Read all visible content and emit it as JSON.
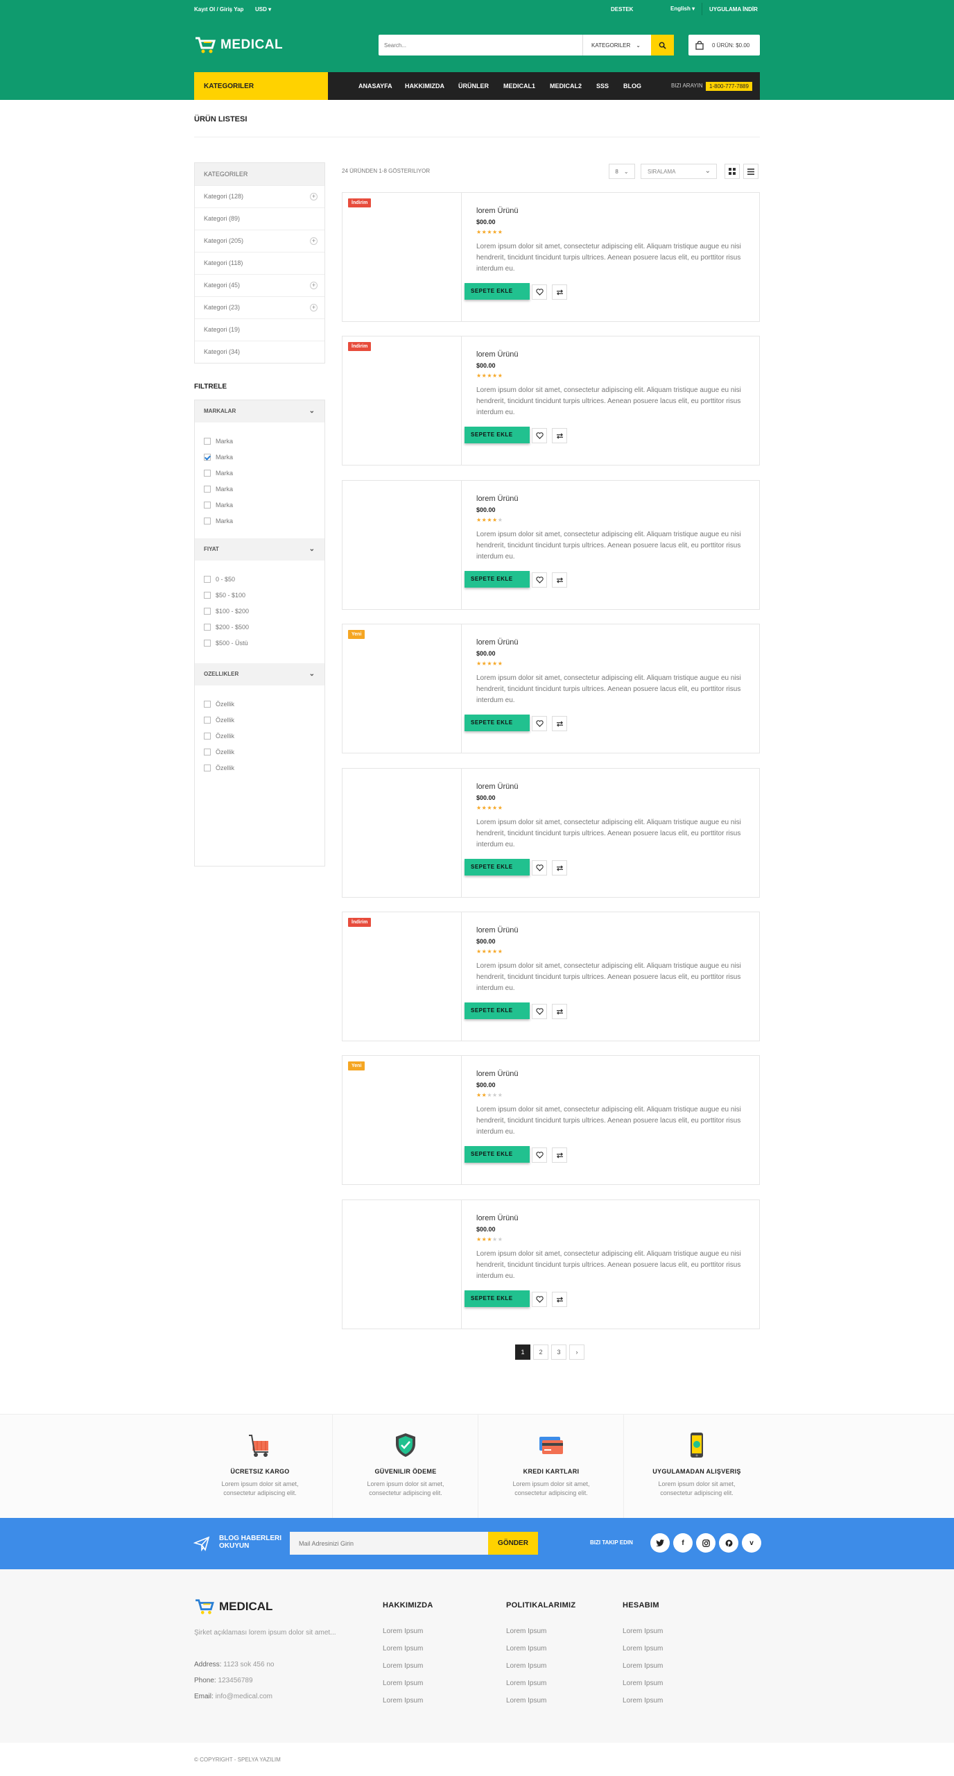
{
  "topbar": {
    "login": "Kayıt Ol / Giriş Yap",
    "currency": "USD",
    "support": "DESTEK",
    "language": "English",
    "app_download": "UYGULAMA İNDİR"
  },
  "brand": {
    "name": "MEDICAL"
  },
  "search": {
    "placeholder": "Search...",
    "category": "KATEGORILER"
  },
  "cart": {
    "label": "0 ÜRÜN: $0.00"
  },
  "nav": {
    "categories": "KATEGORILER",
    "items": [
      "ANASAYFA",
      "HAKKIMIZDA",
      "ÜRÜNLER",
      "MEDICAL1",
      "MEDICAL2",
      "SSS",
      "BLOG"
    ],
    "call_label": "BIZI ARAYIN",
    "call_number": "1-800-777-7889"
  },
  "page": {
    "title": "ÜRÜN LISTESI"
  },
  "sidebar": {
    "categories_title": "KATEGORILER",
    "categories": [
      {
        "label": "Kategori",
        "count": "(128)",
        "expandable": true
      },
      {
        "label": "Kategori",
        "count": "(89)",
        "expandable": false
      },
      {
        "label": "Kategori",
        "count": "(205)",
        "expandable": true
      },
      {
        "label": "Kategori",
        "count": "(118)",
        "expandable": false
      },
      {
        "label": "Kategori",
        "count": "(45)",
        "expandable": true
      },
      {
        "label": "Kategori",
        "count": "(23)",
        "expandable": true
      },
      {
        "label": "Kategori",
        "count": "(19)",
        "expandable": false
      },
      {
        "label": "Kategori",
        "count": "(34)",
        "expandable": false
      }
    ],
    "filter_title": "FILTRELE",
    "brands_title": "MARKALAR",
    "brands": [
      {
        "label": "Marka",
        "checked": false
      },
      {
        "label": "Marka",
        "checked": true
      },
      {
        "label": "Marka",
        "checked": false
      },
      {
        "label": "Marka",
        "checked": false
      },
      {
        "label": "Marka",
        "checked": false
      },
      {
        "label": "Marka",
        "checked": false
      }
    ],
    "price_title": "FIYAT",
    "prices": [
      "0 - $50",
      "$50 - $100",
      "$100 - $200",
      "$200 - $500",
      "$500 - Üstü"
    ],
    "features_title": "OZELLIKLER",
    "features": [
      "Özellik",
      "Özellik",
      "Özellik",
      "Özellik",
      "Özellik"
    ]
  },
  "listing": {
    "showing": "24 ÜRÜNDEN 1-8 GÖSTERILIYOR",
    "per_page": "8",
    "sort": "SIRALAMA"
  },
  "products": [
    {
      "name": "lorem Ürünü",
      "price": "$00.00",
      "rating": 5,
      "badge": "İndirim",
      "badge_color": "#e74c3c",
      "desc": "Lorem ipsum dolor sit amet, consectetur adipiscing elit. Aliquam tristique augue eu nisi hendrerit, tincidunt tincidunt turpis ultrices. Aenean posuere lacus elit, eu porttitor risus interdum eu.",
      "add_label": "SEPETE EKLE"
    },
    {
      "name": "lorem Ürünü",
      "price": "$00.00",
      "rating": 5,
      "badge": "İndirim",
      "badge_color": "#e74c3c",
      "desc": "Lorem ipsum dolor sit amet, consectetur adipiscing elit. Aliquam tristique augue eu nisi hendrerit, tincidunt tincidunt turpis ultrices. Aenean posuere lacus elit, eu porttitor risus interdum eu.",
      "add_label": "SEPETE EKLE"
    },
    {
      "name": "lorem Ürünü",
      "price": "$00.00",
      "rating": 4,
      "badge": "",
      "badge_color": "",
      "desc": "Lorem ipsum dolor sit amet, consectetur adipiscing elit. Aliquam tristique augue eu nisi hendrerit, tincidunt tincidunt turpis ultrices. Aenean posuere lacus elit, eu porttitor risus interdum eu.",
      "add_label": "SEPETE EKLE"
    },
    {
      "name": "lorem Ürünü",
      "price": "$00.00",
      "rating": 5,
      "badge": "Yeni",
      "badge_color": "#f5a623",
      "desc": "Lorem ipsum dolor sit amet, consectetur adipiscing elit. Aliquam tristique augue eu nisi hendrerit, tincidunt tincidunt turpis ultrices. Aenean posuere lacus elit, eu porttitor risus interdum eu.",
      "add_label": "SEPETE EKLE"
    },
    {
      "name": "lorem Ürünü",
      "price": "$00.00",
      "rating": 5,
      "badge": "",
      "badge_color": "",
      "desc": "Lorem ipsum dolor sit amet, consectetur adipiscing elit. Aliquam tristique augue eu nisi hendrerit, tincidunt tincidunt turpis ultrices. Aenean posuere lacus elit, eu porttitor risus interdum eu.",
      "add_label": "SEPETE EKLE"
    },
    {
      "name": "lorem Ürünü",
      "price": "$00.00",
      "rating": 5,
      "badge": "İndirim",
      "badge_color": "#e74c3c",
      "desc": "Lorem ipsum dolor sit amet, consectetur adipiscing elit. Aliquam tristique augue eu nisi hendrerit, tincidunt tincidunt turpis ultrices. Aenean posuere lacus elit, eu porttitor risus interdum eu.",
      "add_label": "SEPETE EKLE"
    },
    {
      "name": "lorem Ürünü",
      "price": "$00.00",
      "rating": 2,
      "badge": "Yeni",
      "badge_color": "#f5a623",
      "desc": "Lorem ipsum dolor sit amet, consectetur adipiscing elit. Aliquam tristique augue eu nisi hendrerit, tincidunt tincidunt turpis ultrices. Aenean posuere lacus elit, eu porttitor risus interdum eu.",
      "add_label": "SEPETE EKLE"
    },
    {
      "name": "lorem Ürünü",
      "price": "$00.00",
      "rating": 3,
      "badge": "",
      "badge_color": "",
      "desc": "Lorem ipsum dolor sit amet, consectetur adipiscing elit. Aliquam tristique augue eu nisi hendrerit, tincidunt tincidunt turpis ultrices. Aenean posuere lacus elit, eu porttitor risus interdum eu.",
      "add_label": "SEPETE EKLE"
    }
  ],
  "pagination": [
    "1",
    "2",
    "3",
    "›"
  ],
  "features": [
    {
      "title": "ÜCRETSIZ KARGO",
      "desc": "Lorem ipsum dolor sit amet, consectetur adipiscing elit.",
      "icon": "truck-icon"
    },
    {
      "title": "GÜVENILIR ÖDEME",
      "desc": "Lorem ipsum dolor sit amet, consectetur adipiscing elit.",
      "icon": "shield-icon"
    },
    {
      "title": "KREDI KARTLARI",
      "desc": "Lorem ipsum dolor sit amet, consectetur adipiscing elit.",
      "icon": "credit-card-icon"
    },
    {
      "title": "UYGULAMADAN ALIŞVERIŞ",
      "desc": "Lorem ipsum dolor sit amet, consectetur adipiscing elit.",
      "icon": "phone-icon"
    }
  ],
  "newsletter": {
    "label": "BLOG HABERLERI OKUYUN",
    "placeholder": "Mail Adresinizi Girin",
    "button": "GÖNDER",
    "follow": "BIZI TAKIP EDIN",
    "social": [
      "twitter",
      "facebook",
      "instagram",
      "pinterest",
      "vimeo"
    ]
  },
  "footer": {
    "brand": "MEDICAL",
    "desc": "Şirket açıklaması lorem ipsum dolor sit amet...",
    "address_label": "Address:",
    "address": "1123 sok 456 no",
    "phone_label": "Phone:",
    "phone": "123456789",
    "email_label": "Email:",
    "email": "info@medical.com",
    "columns": [
      {
        "title": "HAKKIMIZDA",
        "links": [
          "Lorem Ipsum",
          "Lorem Ipsum",
          "Lorem Ipsum",
          "Lorem Ipsum",
          "Lorem Ipsum"
        ]
      },
      {
        "title": "POLITIKALARIMIZ",
        "links": [
          "Lorem Ipsum",
          "Lorem Ipsum",
          "Lorem Ipsum",
          "Lorem Ipsum",
          "Lorem Ipsum"
        ]
      },
      {
        "title": "HESABIM",
        "links": [
          "Lorem Ipsum",
          "Lorem Ipsum",
          "Lorem Ipsum",
          "Lorem Ipsum",
          "Lorem Ipsum"
        ]
      }
    ],
    "copyright": "© COPYRIGHT - SPELYA YAZILIM"
  },
  "colors": {
    "primary": "#0f9b6e",
    "accent": "#ffd200",
    "button": "#21c18f",
    "newsletter": "#3d8ce8"
  }
}
